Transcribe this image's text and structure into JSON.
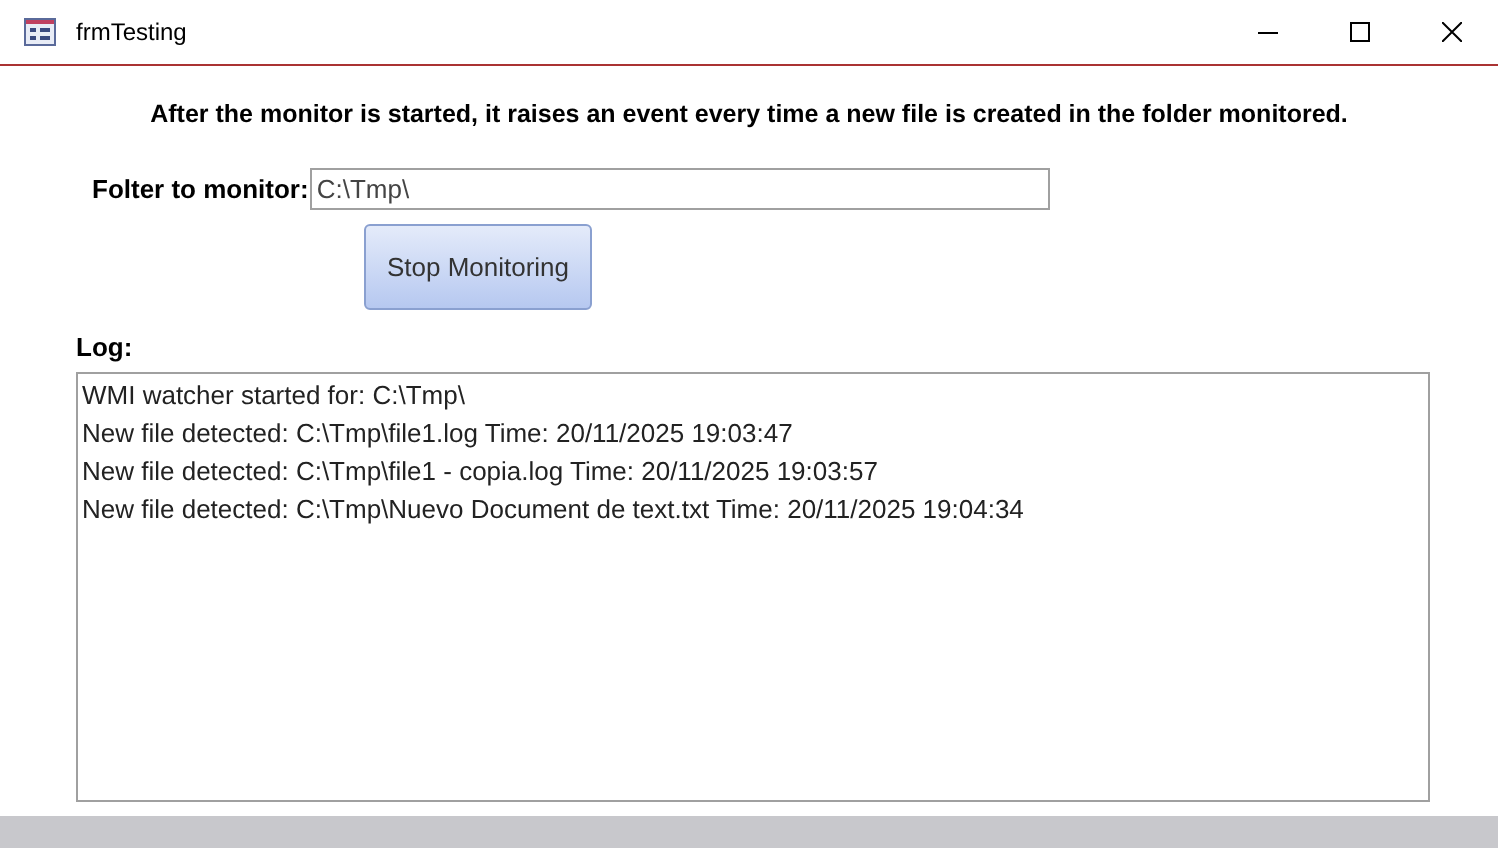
{
  "window": {
    "title": "frmTesting"
  },
  "heading": "After the monitor is started, it raises an event every time a new file is created in the folder monitored.",
  "folder": {
    "label": "Folter to monitor:",
    "value": "C:\\Tmp\\"
  },
  "button": "Stop Monitoring",
  "log": {
    "label": "Log:",
    "lines": [
      "WMI watcher started for: C:\\Tmp\\",
      "New file detected: C:\\Tmp\\file1.log Time: 20/11/2025 19:03:47",
      "New file detected: C:\\Tmp\\file1 - copia.log Time: 20/11/2025 19:03:57",
      "New file detected: C:\\Tmp\\Nuevo Document de text.txt Time: 20/11/2025 19:04:34"
    ]
  }
}
